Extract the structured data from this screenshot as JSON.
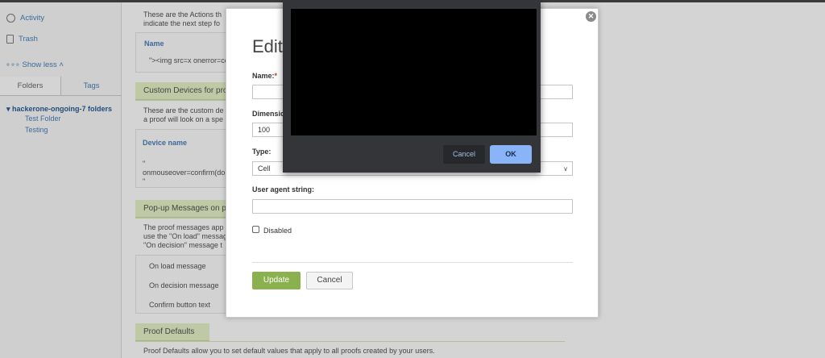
{
  "sidebar": {
    "activity": "Activity",
    "trash": "Trash",
    "show_less": "∘∘∘ Show less ˄",
    "tabs": [
      "Folders",
      "Tags"
    ],
    "folder_root": "▾ hackerone-ongoing-7 folders",
    "folders": [
      "Test Folder",
      "Testing"
    ]
  },
  "main": {
    "actions_text_1": "These are the Actions th",
    "actions_text_2": "indicate the next step fo",
    "actions_table_header": "Name",
    "actions_table_cell": "\"><img src=x onerror=co",
    "custom_devices_title": "Custom Devices for pro",
    "custom_devices_text_1": "These are the custom de",
    "custom_devices_text_2": "a proof will look on a spe",
    "device_table_header": "Device name",
    "device_cell_1": "\"",
    "device_cell_2": "onmouseover=confirm(do",
    "device_cell_3": "\"",
    "popup_title": "Pop-up Messages on p",
    "popup_text_1": "The proof messages app",
    "popup_text_2": "use the \"On load\" messag",
    "popup_text_3": "\"On decision\" message t",
    "popup_rows": [
      "On load message",
      "On decision message",
      "Confirm button text"
    ],
    "proof_defaults_title": "Proof Defaults",
    "proof_defaults_text": "Proof Defaults allow you to set default values that apply to all proofs created by your users."
  },
  "modal": {
    "close": "✕",
    "title": "Edit",
    "name_label": "Name:",
    "required_mark": "*",
    "name_value": "",
    "dimension_label": "Dimensio",
    "dimension_value": "100",
    "type_label": "Type:",
    "type_value": "Cell",
    "select_arrow": "∨",
    "user_agent_label": "User agent string:",
    "user_agent_value": "",
    "disabled_label": "Disabled",
    "update_button": "Update",
    "cancel_button": "Cancel"
  },
  "dialog": {
    "cancel_button": "Cancel",
    "ok_button": "OK"
  }
}
